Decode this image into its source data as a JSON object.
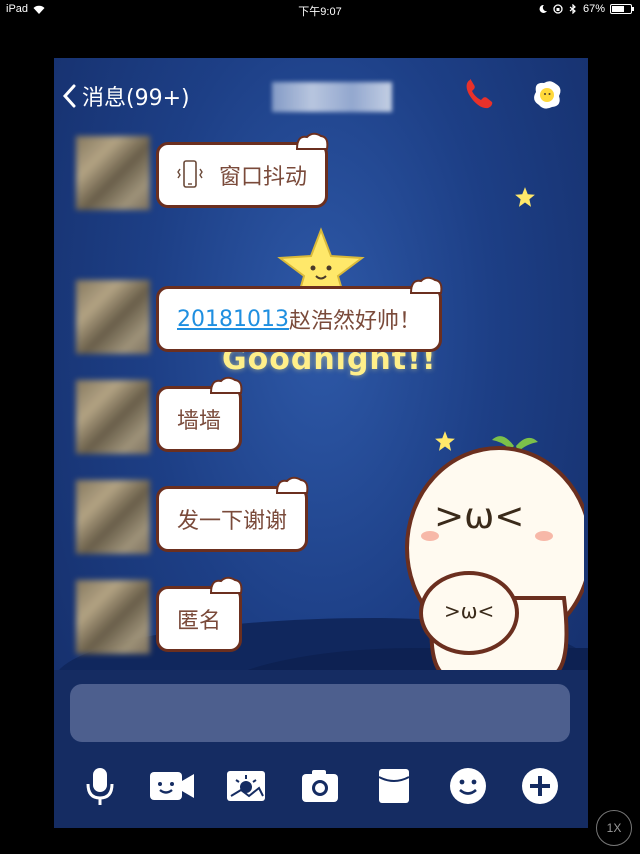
{
  "status_bar": {
    "device": "iPad",
    "time": "下午9:07",
    "battery": "67%"
  },
  "nav": {
    "back_label": "消息(99+)"
  },
  "messages": [
    {
      "type": "shake",
      "text": "窗口抖动"
    },
    {
      "type": "text",
      "link": "20181013",
      "text": "赵浩然好帅！"
    },
    {
      "type": "text",
      "text": "墙墙"
    },
    {
      "type": "text",
      "text": "发一下谢谢"
    },
    {
      "type": "text",
      "text": "匿名"
    }
  ],
  "background_text": "Goodnight!!",
  "toolbar": {
    "icons": [
      "microphone-icon",
      "video-call-icon",
      "image-icon",
      "camera-icon",
      "red-packet-icon",
      "emoji-icon",
      "plus-icon"
    ]
  },
  "zoom_badge": "1X",
  "colors": {
    "accent_link": "#1f8fe0",
    "bubble_border": "#6b2f1f",
    "call_red": "#e8312a"
  }
}
